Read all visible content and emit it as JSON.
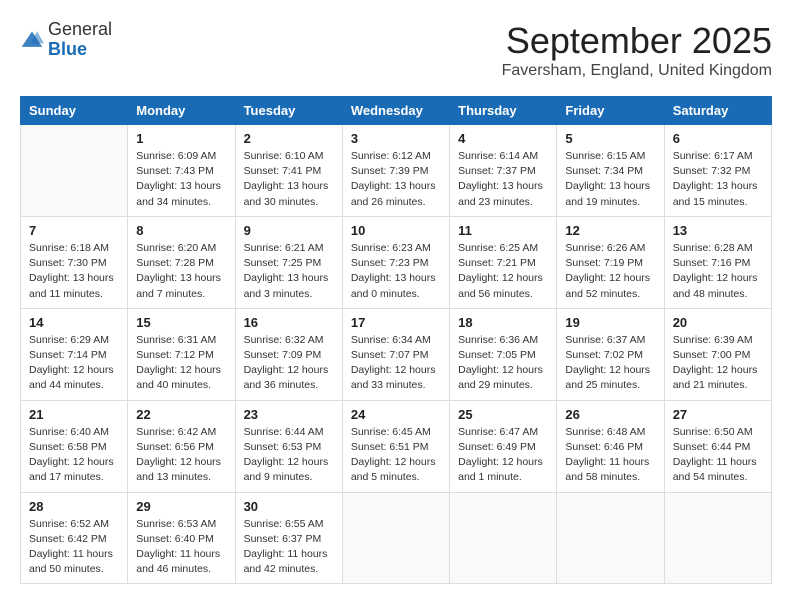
{
  "header": {
    "logo": {
      "line1": "General",
      "line2": "Blue"
    },
    "title": "September 2025",
    "location": "Faversham, England, United Kingdom"
  },
  "weekdays": [
    "Sunday",
    "Monday",
    "Tuesday",
    "Wednesday",
    "Thursday",
    "Friday",
    "Saturday"
  ],
  "weeks": [
    [
      {
        "day": "",
        "info": ""
      },
      {
        "day": "1",
        "info": "Sunrise: 6:09 AM\nSunset: 7:43 PM\nDaylight: 13 hours\nand 34 minutes."
      },
      {
        "day": "2",
        "info": "Sunrise: 6:10 AM\nSunset: 7:41 PM\nDaylight: 13 hours\nand 30 minutes."
      },
      {
        "day": "3",
        "info": "Sunrise: 6:12 AM\nSunset: 7:39 PM\nDaylight: 13 hours\nand 26 minutes."
      },
      {
        "day": "4",
        "info": "Sunrise: 6:14 AM\nSunset: 7:37 PM\nDaylight: 13 hours\nand 23 minutes."
      },
      {
        "day": "5",
        "info": "Sunrise: 6:15 AM\nSunset: 7:34 PM\nDaylight: 13 hours\nand 19 minutes."
      },
      {
        "day": "6",
        "info": "Sunrise: 6:17 AM\nSunset: 7:32 PM\nDaylight: 13 hours\nand 15 minutes."
      }
    ],
    [
      {
        "day": "7",
        "info": "Sunrise: 6:18 AM\nSunset: 7:30 PM\nDaylight: 13 hours\nand 11 minutes."
      },
      {
        "day": "8",
        "info": "Sunrise: 6:20 AM\nSunset: 7:28 PM\nDaylight: 13 hours\nand 7 minutes."
      },
      {
        "day": "9",
        "info": "Sunrise: 6:21 AM\nSunset: 7:25 PM\nDaylight: 13 hours\nand 3 minutes."
      },
      {
        "day": "10",
        "info": "Sunrise: 6:23 AM\nSunset: 7:23 PM\nDaylight: 13 hours\nand 0 minutes."
      },
      {
        "day": "11",
        "info": "Sunrise: 6:25 AM\nSunset: 7:21 PM\nDaylight: 12 hours\nand 56 minutes."
      },
      {
        "day": "12",
        "info": "Sunrise: 6:26 AM\nSunset: 7:19 PM\nDaylight: 12 hours\nand 52 minutes."
      },
      {
        "day": "13",
        "info": "Sunrise: 6:28 AM\nSunset: 7:16 PM\nDaylight: 12 hours\nand 48 minutes."
      }
    ],
    [
      {
        "day": "14",
        "info": "Sunrise: 6:29 AM\nSunset: 7:14 PM\nDaylight: 12 hours\nand 44 minutes."
      },
      {
        "day": "15",
        "info": "Sunrise: 6:31 AM\nSunset: 7:12 PM\nDaylight: 12 hours\nand 40 minutes."
      },
      {
        "day": "16",
        "info": "Sunrise: 6:32 AM\nSunset: 7:09 PM\nDaylight: 12 hours\nand 36 minutes."
      },
      {
        "day": "17",
        "info": "Sunrise: 6:34 AM\nSunset: 7:07 PM\nDaylight: 12 hours\nand 33 minutes."
      },
      {
        "day": "18",
        "info": "Sunrise: 6:36 AM\nSunset: 7:05 PM\nDaylight: 12 hours\nand 29 minutes."
      },
      {
        "day": "19",
        "info": "Sunrise: 6:37 AM\nSunset: 7:02 PM\nDaylight: 12 hours\nand 25 minutes."
      },
      {
        "day": "20",
        "info": "Sunrise: 6:39 AM\nSunset: 7:00 PM\nDaylight: 12 hours\nand 21 minutes."
      }
    ],
    [
      {
        "day": "21",
        "info": "Sunrise: 6:40 AM\nSunset: 6:58 PM\nDaylight: 12 hours\nand 17 minutes."
      },
      {
        "day": "22",
        "info": "Sunrise: 6:42 AM\nSunset: 6:56 PM\nDaylight: 12 hours\nand 13 minutes."
      },
      {
        "day": "23",
        "info": "Sunrise: 6:44 AM\nSunset: 6:53 PM\nDaylight: 12 hours\nand 9 minutes."
      },
      {
        "day": "24",
        "info": "Sunrise: 6:45 AM\nSunset: 6:51 PM\nDaylight: 12 hours\nand 5 minutes."
      },
      {
        "day": "25",
        "info": "Sunrise: 6:47 AM\nSunset: 6:49 PM\nDaylight: 12 hours\nand 1 minute."
      },
      {
        "day": "26",
        "info": "Sunrise: 6:48 AM\nSunset: 6:46 PM\nDaylight: 11 hours\nand 58 minutes."
      },
      {
        "day": "27",
        "info": "Sunrise: 6:50 AM\nSunset: 6:44 PM\nDaylight: 11 hours\nand 54 minutes."
      }
    ],
    [
      {
        "day": "28",
        "info": "Sunrise: 6:52 AM\nSunset: 6:42 PM\nDaylight: 11 hours\nand 50 minutes."
      },
      {
        "day": "29",
        "info": "Sunrise: 6:53 AM\nSunset: 6:40 PM\nDaylight: 11 hours\nand 46 minutes."
      },
      {
        "day": "30",
        "info": "Sunrise: 6:55 AM\nSunset: 6:37 PM\nDaylight: 11 hours\nand 42 minutes."
      },
      {
        "day": "",
        "info": ""
      },
      {
        "day": "",
        "info": ""
      },
      {
        "day": "",
        "info": ""
      },
      {
        "day": "",
        "info": ""
      }
    ]
  ]
}
